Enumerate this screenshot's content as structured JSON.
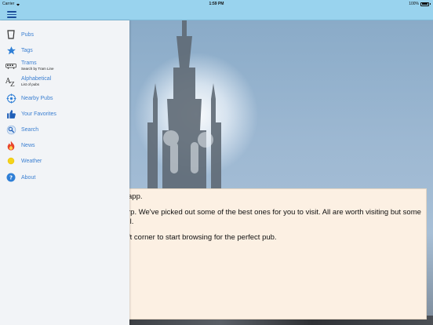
{
  "status_bar": {
    "carrier": "Carrier",
    "time": "1:59 PM",
    "battery": "100%"
  },
  "nav": {
    "menu_icon": "hamburger-icon"
  },
  "menu": {
    "items": [
      {
        "label": "Pubs",
        "sub": "",
        "icon": "beer-glass-icon"
      },
      {
        "label": "Tags",
        "sub": "",
        "icon": "star-icon"
      },
      {
        "label": "Trams",
        "sub": "Search by Tram Line",
        "icon": "tram-icon"
      },
      {
        "label": "Alphabetical",
        "sub": "List of pubs",
        "icon": "az-icon"
      },
      {
        "label": "Nearby Pubs",
        "sub": "",
        "icon": "location-icon"
      },
      {
        "label": "Your Favorites",
        "sub": "",
        "icon": "thumbs-up-icon"
      },
      {
        "label": "Search",
        "sub": "",
        "icon": "search-icon"
      },
      {
        "label": "News",
        "sub": "",
        "icon": "flame-icon"
      },
      {
        "label": "Weather",
        "sub": "",
        "icon": "sun-icon"
      },
      {
        "label": "About",
        "sub": "",
        "icon": "info-icon"
      }
    ]
  },
  "content": {
    "line1": "app.",
    "line2a": "rp. We've picked out some of the best ones for you to visit. All are worth visiting but some",
    "line2b": "ıl.",
    "line3": "ft corner to start browsing for the perfect pub."
  },
  "colors": {
    "bar": "#99d3ee",
    "accent": "#3b7fd1",
    "card": "#fcf0e3",
    "menu_bg": "#f2f4f7"
  }
}
